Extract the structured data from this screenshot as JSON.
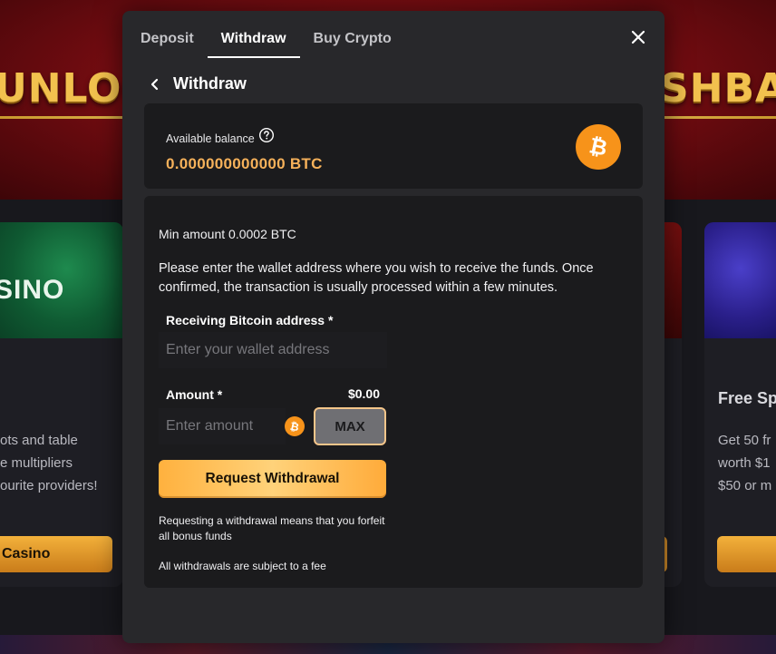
{
  "background": {
    "hero_left_text": "UNLOC",
    "hero_right_text": "SHBA",
    "left_card": {
      "image_label": "SINO",
      "description": [
        "ots and table",
        "e multipliers",
        "ourite providers!"
      ],
      "button_label": "Casino"
    },
    "right_card": {
      "title": "Free Sp",
      "description": [
        "Get 50 fr",
        "worth $1",
        "$50 or m"
      ]
    }
  },
  "modal": {
    "tabs": [
      {
        "label": "Deposit",
        "active": false
      },
      {
        "label": "Withdraw",
        "active": true
      },
      {
        "label": "Buy Crypto",
        "active": false
      }
    ],
    "close_icon": "close-icon",
    "back_icon": "chevron-left-icon",
    "title": "Withdraw",
    "balance": {
      "label": "Available balance",
      "help_icon": "question-circle-icon",
      "value": "0.000000000000 BTC",
      "currency_icon": "bitcoin-icon"
    },
    "form": {
      "min_amount": "Min amount 0.0002 BTC",
      "info": "Please enter the wallet address where you wish to receive the funds. Once confirmed, the transaction is usually processed within a few minutes.",
      "address_label": "Receiving Bitcoin address *",
      "address_placeholder": "Enter your wallet address",
      "address_value": "",
      "amount_label": "Amount *",
      "amount_usd": "$0.00",
      "amount_placeholder": "Enter amount",
      "amount_value": "",
      "max_label": "MAX",
      "submit_label": "Request Withdrawal",
      "note_bonus": "Requesting a withdrawal means that you forfeit all bonus funds",
      "note_fee": "All withdrawals are subject to a fee"
    }
  },
  "colors": {
    "accent_orange": "#f6b15a",
    "bitcoin_orange": "#f7931a",
    "modal_bg": "#28282b",
    "card_bg": "#1b1b1d"
  }
}
